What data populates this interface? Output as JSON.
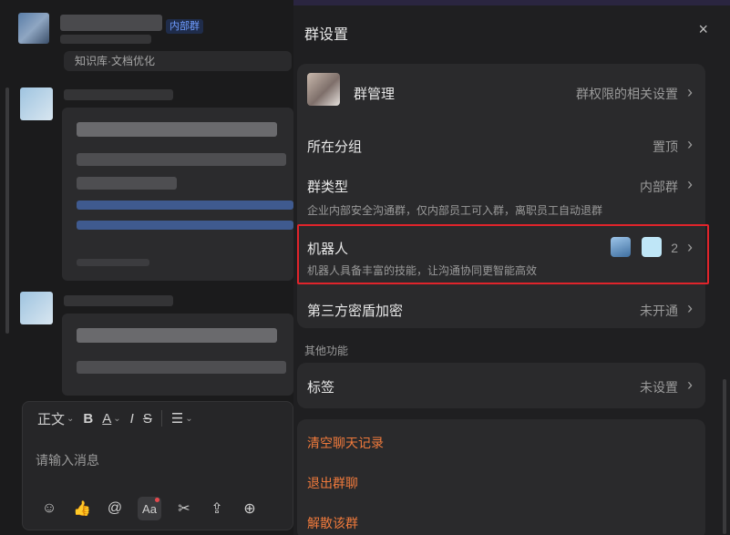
{
  "chat": {
    "tag": "内部群",
    "kb_chip": "知识库·文档优化",
    "composer": {
      "format_label": "正文",
      "placeholder": "请输入消息",
      "tool_b": "B",
      "tool_a": "A",
      "tool_i": "I",
      "tool_s": "S",
      "tool_list": "☰",
      "aa_label": "Aa"
    }
  },
  "panel": {
    "title": "群设置",
    "close": "×",
    "rows": {
      "manage": {
        "label": "群管理",
        "value": "群权限的相关设置"
      },
      "group": {
        "label": "所在分组",
        "value": "置顶"
      },
      "type": {
        "label": "群类型",
        "value": "内部群",
        "sub": "企业内部安全沟通群，仅内部员工可入群，离职员工自动退群"
      },
      "bot": {
        "label": "机器人",
        "value": "2",
        "sub": "机器人具备丰富的技能，让沟通协同更智能高效"
      },
      "encrypt": {
        "label": "第三方密盾加密",
        "value": "未开通"
      }
    },
    "section_other": "其他功能",
    "tag_row": {
      "label": "标签",
      "value": "未设置"
    },
    "actions": {
      "clear": "清空聊天记录",
      "leave": "退出群聊",
      "dissolve": "解散该群"
    },
    "chevron": "›"
  },
  "colors": {
    "accent_red": "#e0242b",
    "danger_text": "#f07a3c",
    "tag_blue": "#6f9cff"
  }
}
